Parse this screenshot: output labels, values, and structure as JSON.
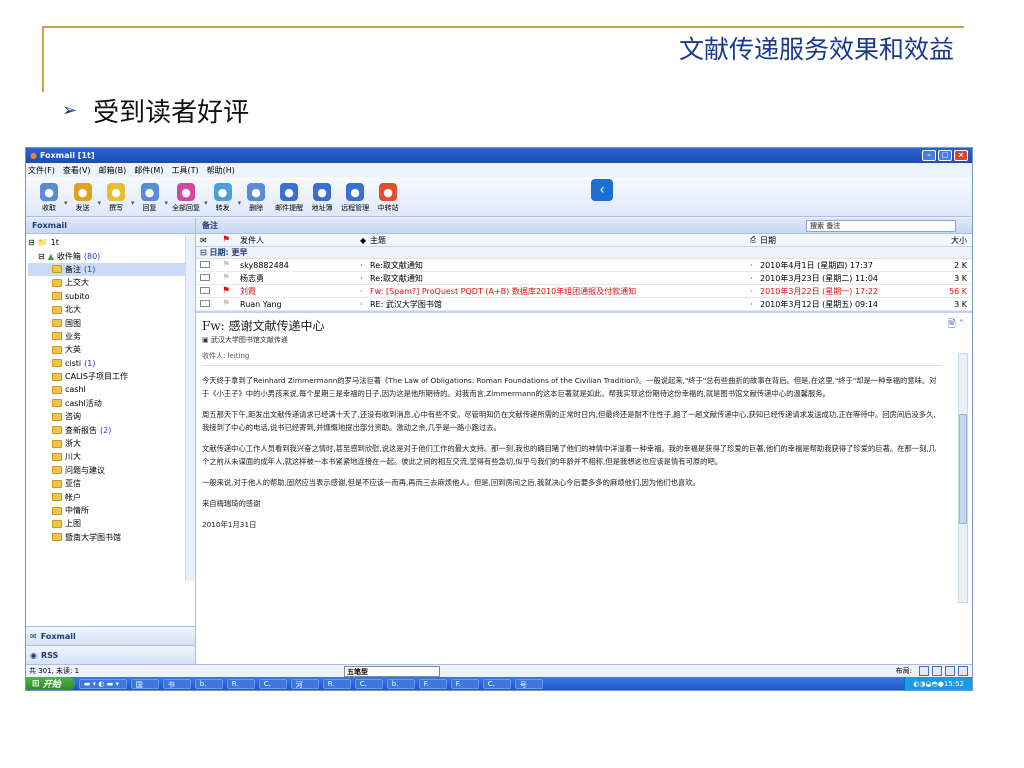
{
  "slide": {
    "title": "文献传递服务效果和效益",
    "bullet_marker": "➢",
    "bullet_text": "受到读者好评"
  },
  "window": {
    "title": "Foxmail [1t]",
    "menu": [
      "文件(F)",
      "查看(V)",
      "邮箱(B)",
      "邮件(M)",
      "工具(T)",
      "帮助(H)"
    ],
    "toolbar": [
      {
        "label": "收取",
        "icon": "receive-icon",
        "color": "#5a8bd8"
      },
      {
        "label": "发送",
        "icon": "send-icon",
        "color": "#e6a020"
      },
      {
        "label": "撰写",
        "icon": "compose-icon",
        "color": "#e6c030"
      },
      {
        "label": "回复",
        "icon": "reply-icon",
        "color": "#5a8bd8"
      },
      {
        "label": "全部回复",
        "icon": "reply-all-icon",
        "color": "#d04aa0"
      },
      {
        "label": "转发",
        "icon": "forward-icon",
        "color": "#4aa0d8"
      },
      {
        "label": "删除",
        "icon": "delete-icon",
        "color": "#5a8bd8"
      },
      {
        "label": "邮件提醒",
        "icon": "reminder-icon",
        "color": "#3a6fd0"
      },
      {
        "label": "地址簿",
        "icon": "address-book-icon",
        "color": "#3a6fd0"
      },
      {
        "label": "远程管理",
        "icon": "remote-icon",
        "color": "#3a6fd0"
      },
      {
        "label": "中转站",
        "icon": "transfer-icon",
        "color": "#e05030"
      }
    ],
    "toolbar_sep": "▾"
  },
  "sidebar": {
    "header": "Foxmail",
    "account": "1t",
    "inbox": {
      "label": "收件箱",
      "count": "(80)"
    },
    "folders": [
      {
        "label": "备注",
        "count": "(1)",
        "selected": true
      },
      {
        "label": "上交大",
        "count": ""
      },
      {
        "label": "subito",
        "count": ""
      },
      {
        "label": "北大",
        "count": ""
      },
      {
        "label": "国图",
        "count": ""
      },
      {
        "label": "业务",
        "count": ""
      },
      {
        "label": "大英",
        "count": ""
      },
      {
        "label": "cisti",
        "count": "(1)"
      },
      {
        "label": "CALIS子项目工作",
        "count": ""
      },
      {
        "label": "cashl",
        "count": ""
      },
      {
        "label": "cashl活动",
        "count": ""
      },
      {
        "label": "咨询",
        "count": ""
      },
      {
        "label": "查新报告",
        "count": "(2)"
      },
      {
        "label": "浙大",
        "count": ""
      },
      {
        "label": "川大",
        "count": ""
      },
      {
        "label": "问题与建议",
        "count": ""
      },
      {
        "label": "亚信",
        "count": ""
      },
      {
        "label": "帐户",
        "count": ""
      },
      {
        "label": "中情所",
        "count": ""
      },
      {
        "label": "上图",
        "count": ""
      },
      {
        "label": "暨南大学图书馆",
        "count": ""
      }
    ],
    "bottom_tabs": [
      "Foxmail",
      "RSS"
    ]
  },
  "main": {
    "folder_title": "备注",
    "search_placeholder": "搜索 备注",
    "columns": {
      "from": "发件人",
      "subject": "主题",
      "date": "日期",
      "size": "大小"
    },
    "group": "日期: 更早",
    "messages": [
      {
        "from": "sky8882484",
        "subject": "Re:取文献通知",
        "date": "2010年4月1日 (星期四) 17:37",
        "size": "2 K",
        "flag": "grey",
        "red": false
      },
      {
        "from": "杨志勇",
        "subject": "Re:取文献通知",
        "date": "2010年3月23日 (星期二) 11:04",
        "size": "3 K",
        "flag": "grey",
        "red": false
      },
      {
        "from": "刘霞",
        "subject": "Fw: [Spam?] ProQuest PQDT (A+B) 数据库2010年组团通报及付款通知",
        "date": "2010年3月22日 (星期一) 17:22",
        "size": "56 K",
        "flag": "red",
        "red": true
      },
      {
        "from": "Ruan Yang",
        "subject": "RE: 武汉大学图书馆",
        "date": "2010年3月12日 (星期五) 09:14",
        "size": "3 K",
        "flag": "grey",
        "red": false
      }
    ]
  },
  "preview": {
    "subject": "Fw: 感谢文献传递中心",
    "from": "武汉大学图书馆文献传递",
    "to_label": "收件人:",
    "to": "leiting",
    "paragraphs": [
      "今天终于拿到了Reinhard Zimmermann的罗马法巨著《The Law of Obligations: Roman Foundations of the Civilian Tradition》。一般说起来,\"终于\"总有些曲折的故事在背后。但是,在这里,\"终于\"却是一种幸福的意味。对于《小王子》中的小男孩来说,每个星期三是幸福的日子,因为这是他所期待的。对我而言,Zimmermann的这本巨著就是如此。帮我实现这份期待这份幸福的,就是图书馆文献传递中心的温馨服务。",
      "周五那天下午,距发出文献传递请求已经满十天了,还没有收到消息,心中有些不安。尽管明知仍在文献传递所需的正常时日内,但最终还是耐不住性子,跑了一趟文献传递中心,获知已经传递请求发送成功,正在等待中。回房间后没多久,我接到了中心的电话,说书已经寄到,并慷慨地提出部分资助。激动之余,几乎是一路小跑过去。",
      "文献传递中心工作人员看到我兴奋之情时,甚至感到欣慰,说这是对于他们工作的最大支持。那一刻,我也的确目睹了他们的神情中洋溢着一种幸福。我的幸福是获得了珍爱的巨著,他们的幸福是帮助我获得了珍爱的巨著。在那一刻,几个之前从未谋面的成年人,就这样被一本书紧紧地连接在一起。彼此之间的相互交流,显得有些急切,似乎与我们的年龄并不相称,但是我想这也应该是情有可原的吧。",
      "一般来说,对于他人的帮助,固然应当表示感谢,但是不应该一而再,再而三去麻烦他人。但是,回到房间之后,我就决心今后要多多的麻烦他们,因为他们也喜欢。",
      "来自梅瑞琦的感谢",
      "2010年1月31日"
    ]
  },
  "status": {
    "counts": "共 301, 未读: 1",
    "ime": "五笔型",
    "layout_label": "布局:"
  },
  "taskbar": {
    "start": "开始",
    "tasks": [
      "国",
      "书",
      "b.",
      "R.",
      "C.",
      "河",
      "R.",
      "C.",
      "b.",
      "F.",
      "F.",
      "C.",
      "号"
    ],
    "clock": "15:52"
  }
}
